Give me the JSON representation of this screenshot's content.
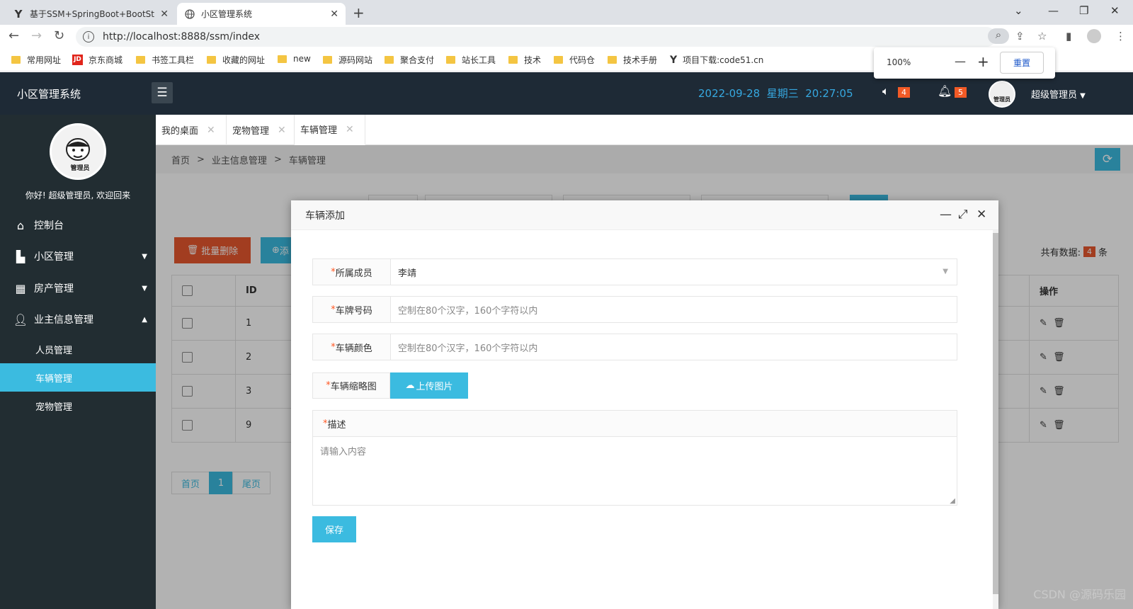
{
  "browser": {
    "tabs": [
      {
        "title": "基于SSM+SpringBoot+BootSt",
        "favicon": "Y"
      },
      {
        "title": "小区管理系统",
        "favicon": "globe"
      }
    ],
    "new_tab": "+",
    "url": "http://localhost:8888/ssm/index",
    "bookmarks": [
      {
        "label": "常用网址",
        "icon": "folder"
      },
      {
        "label": "京东商城",
        "icon": "jd"
      },
      {
        "label": "书签工具栏",
        "icon": "folder"
      },
      {
        "label": "收藏的网址",
        "icon": "folder"
      },
      {
        "label": "new",
        "icon": "folder"
      },
      {
        "label": "源码网站",
        "icon": "folder"
      },
      {
        "label": "聚合支付",
        "icon": "folder"
      },
      {
        "label": "站长工具",
        "icon": "folder"
      },
      {
        "label": "技术",
        "icon": "folder"
      },
      {
        "label": "代码仓",
        "icon": "folder"
      },
      {
        "label": "技术手册",
        "icon": "folder"
      },
      {
        "label": "项目下载:code51.cn",
        "icon": "Y"
      }
    ],
    "zoom": {
      "level": "100%",
      "minus": "—",
      "plus": "+",
      "reset": "重置"
    },
    "jd_logo": "JD",
    "y_logo": "Y"
  },
  "app": {
    "title": "小区管理系统",
    "datetime": "2022-09-28  星期三  20:27:05",
    "speaker_badge": "4",
    "bell_badge": "5",
    "user": "超级管理员"
  },
  "sidebar": {
    "welcome": "你好! 超级管理员, 欢迎回来",
    "avatar_text": "管理员",
    "menu": [
      {
        "label": "控制台",
        "icon": "home-icon"
      },
      {
        "label": "小区管理",
        "icon": "building-icon"
      },
      {
        "label": "房产管理",
        "icon": "city-icon"
      },
      {
        "label": "业主信息管理",
        "icon": "user-icon"
      }
    ],
    "submenu": [
      "人员管理",
      "车辆管理",
      "宠物管理"
    ]
  },
  "page_tabs": [
    {
      "label": "我的桌面"
    },
    {
      "label": "宠物管理"
    },
    {
      "label": "车辆管理"
    }
  ],
  "breadcrumb": [
    "首页",
    ">",
    "业主信息管理",
    ">",
    "车辆管理"
  ],
  "list": {
    "batch_delete": "批量删除",
    "add_partial": "添",
    "total_label": "共有数据:",
    "total": "4",
    "total_unit": "条",
    "col_id": "ID",
    "col_ops": "操作",
    "rows": [
      "1",
      "2",
      "3",
      "9"
    ],
    "pager": {
      "first": "首页",
      "current": "1",
      "last": "尾页"
    }
  },
  "modal": {
    "title": "车辆添加",
    "fields": {
      "owner_label": "所属成员",
      "owner_value": "李靖",
      "plate_label": "车牌号码",
      "plate_placeholder": "空制在80个汉字，160个字符以内",
      "color_label": "车辆颜色",
      "color_placeholder": "空制在80个汉字，160个字符以内",
      "thumb_label": "车辆缩略图",
      "upload_label": "上传图片",
      "desc_label": "描述",
      "desc_placeholder": "请输入内容"
    },
    "required_mark": "*",
    "save": "保存"
  },
  "watermark": "CSDN @源码乐园",
  "colors": {
    "accent": "#3bbbe0",
    "sidebar": "#222d32",
    "header": "#1e2a36",
    "danger": "#e8582e",
    "badge": "#f25a26",
    "datetime": "#36a8e0"
  }
}
